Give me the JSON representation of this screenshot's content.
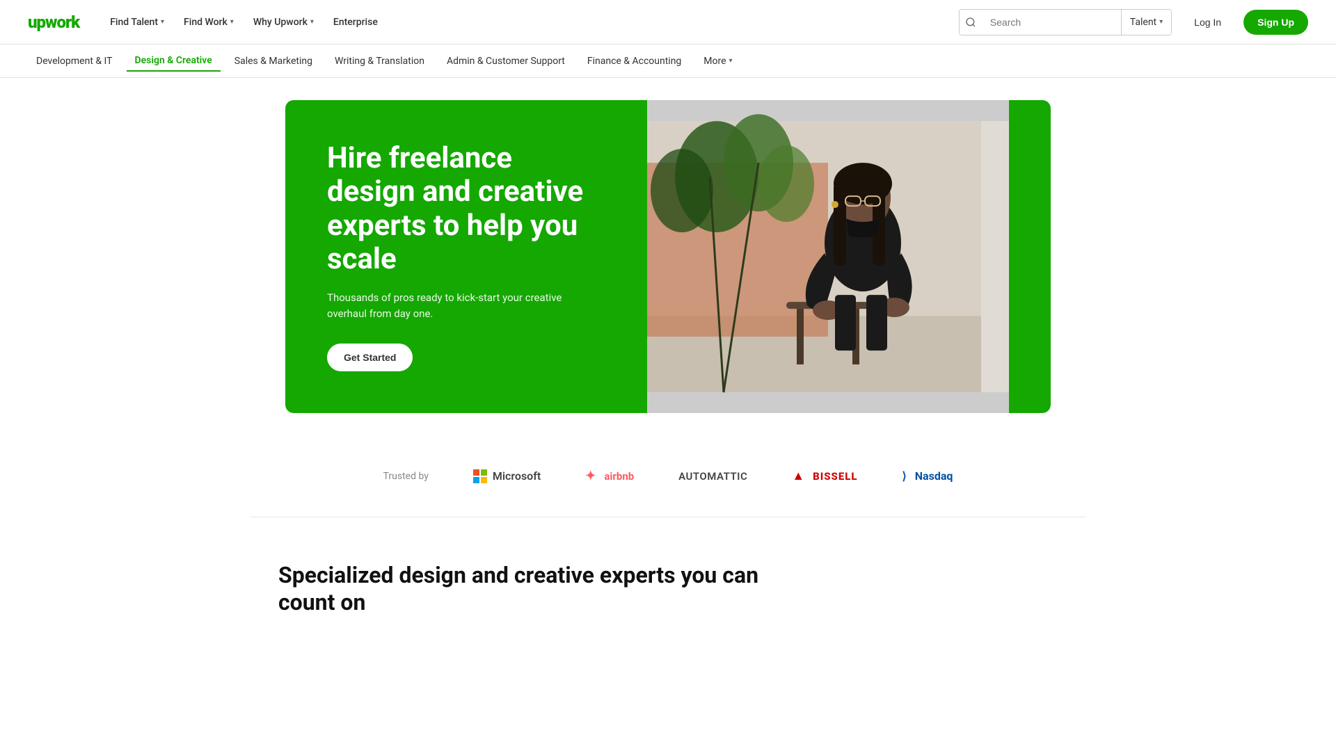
{
  "header": {
    "logo": "upwork",
    "nav": [
      {
        "label": "Find Talent",
        "has_dropdown": true
      },
      {
        "label": "Find Work",
        "has_dropdown": true
      },
      {
        "label": "Why Upwork",
        "has_dropdown": true
      },
      {
        "label": "Enterprise",
        "has_dropdown": false
      }
    ],
    "search": {
      "placeholder": "Search",
      "talent_label": "Talent"
    },
    "login_label": "Log In",
    "signup_label": "Sign Up"
  },
  "sub_nav": {
    "items": [
      {
        "label": "Development & IT",
        "active": false
      },
      {
        "label": "Design & Creative",
        "active": true
      },
      {
        "label": "Sales & Marketing",
        "active": false
      },
      {
        "label": "Writing & Translation",
        "active": false
      },
      {
        "label": "Admin & Customer Support",
        "active": false
      },
      {
        "label": "Finance & Accounting",
        "active": false
      },
      {
        "label": "More",
        "has_dropdown": true,
        "active": false
      }
    ]
  },
  "hero": {
    "title": "Hire freelance design and creative experts to help you scale",
    "subtitle": "Thousands of pros ready to kick-start your creative overhaul from day one.",
    "cta_label": "Get Started"
  },
  "trusted": {
    "label": "Trusted by",
    "brands": [
      {
        "name": "Microsoft",
        "type": "microsoft"
      },
      {
        "name": "airbnb",
        "type": "airbnb"
      },
      {
        "name": "Automattic",
        "type": "automattic"
      },
      {
        "name": "Bissell",
        "type": "bissell"
      },
      {
        "name": "Nasdaq",
        "type": "nasdaq"
      }
    ]
  },
  "bottom": {
    "section_title": "Specialized design and creative experts you can count on"
  }
}
